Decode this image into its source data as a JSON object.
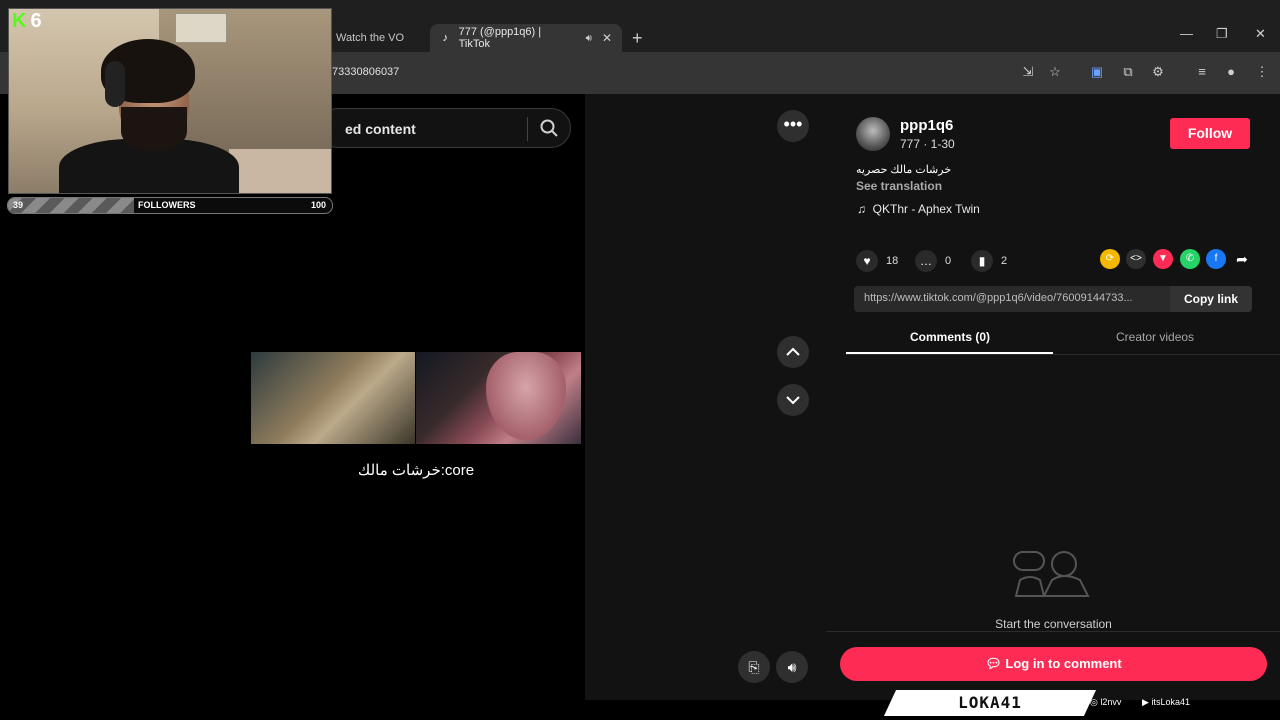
{
  "browser": {
    "tabs": [
      {
        "label": "Watch the VO",
        "active": false
      },
      {
        "label": "777 (@ppp1q6) | TikTok",
        "active": true
      }
    ],
    "url": "73330806037"
  },
  "search": {
    "placeholder": "ed content"
  },
  "video": {
    "caption": "خرشات مالك:core"
  },
  "author": {
    "username": "ppp1q6",
    "subtitle": "777 · 1-30",
    "follow_label": "Follow",
    "description": "خرشات مالك حصريه",
    "see_translation": "See translation",
    "music": "QKThr - Aphex Twin"
  },
  "stats": {
    "likes": "18",
    "comments": "0",
    "saves": "2"
  },
  "share_link": {
    "url": "https://www.tiktok.com/@ppp1q6/video/76009144733...",
    "copy_label": "Copy link"
  },
  "comments_tabs": {
    "comments": "Comments (0)",
    "creator_videos": "Creator videos"
  },
  "empty_state": "Start the conversation",
  "login_label": "Log in to comment",
  "overlay": {
    "badge_count": "6",
    "followers_label": "FOLLOWERS",
    "followers_current": "39",
    "followers_goal": "100",
    "followers_progress": 0.39,
    "brand": "LOKA41",
    "instagram": "l2nvv",
    "youtube": "itsLoka41"
  },
  "colors": {
    "accent": "#fe2c55",
    "kick_green": "#53fc18"
  }
}
